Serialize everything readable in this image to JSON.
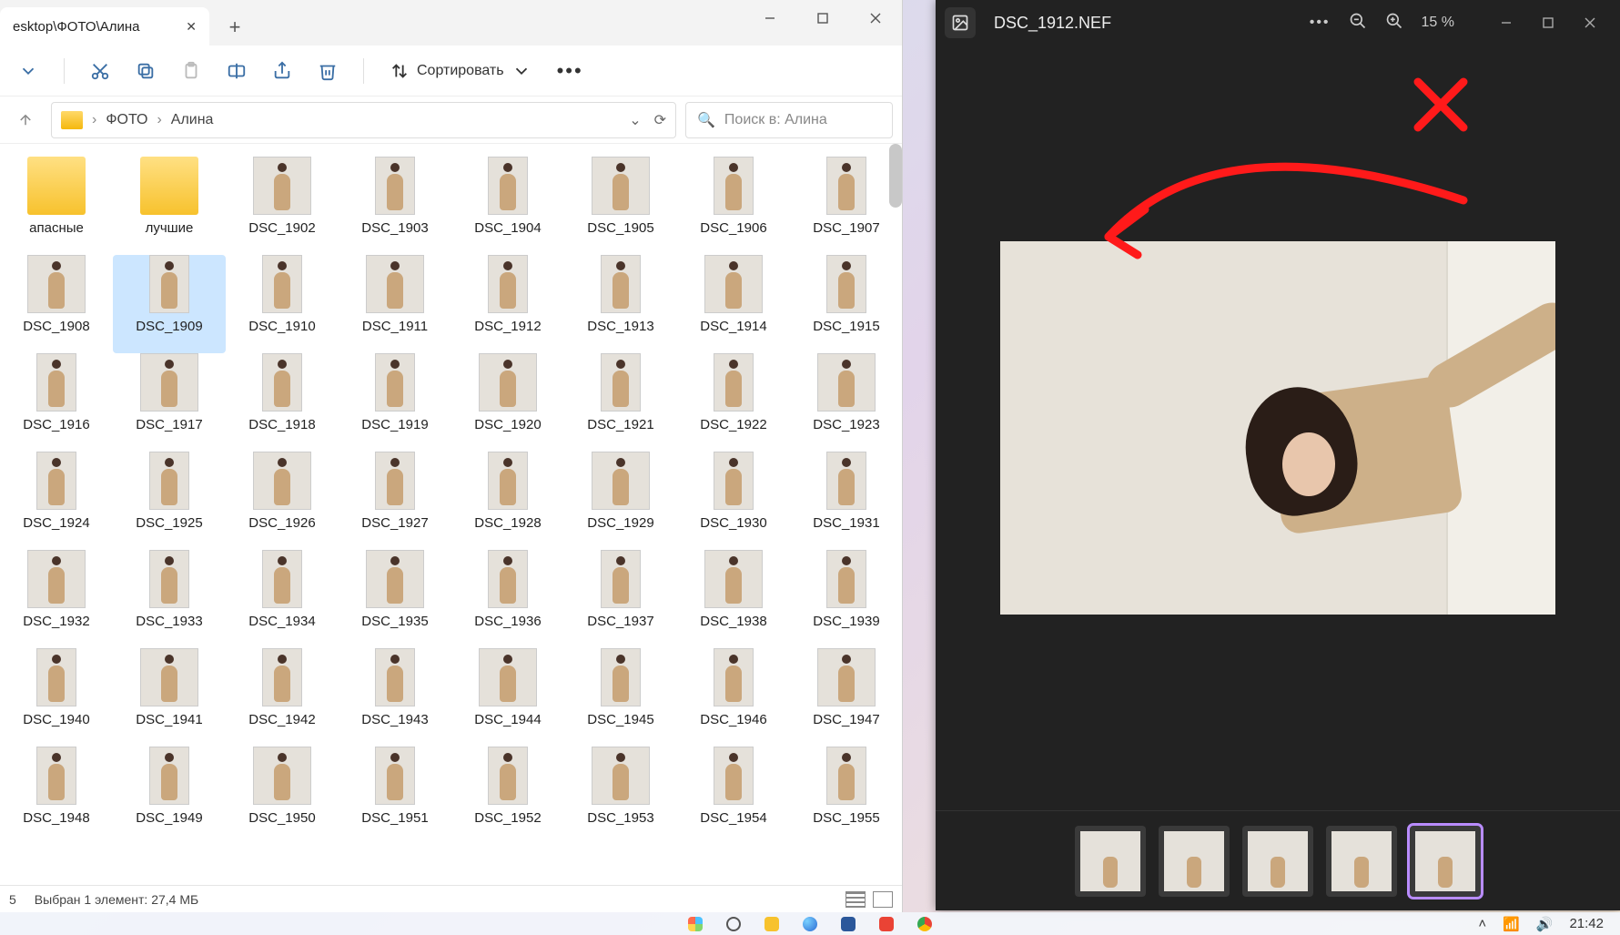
{
  "explorer": {
    "tab_title": "esktop\\ФОТО\\Алина",
    "new_button": "+",
    "sort_label": "Сортировать",
    "breadcrumb": {
      "root": "ФОТО",
      "current": "Алина"
    },
    "search_placeholder": "Поиск в: Алина",
    "folders": [
      "апасные",
      "лучшие"
    ],
    "files": [
      "DSC_1902",
      "DSC_1903",
      "DSC_1904",
      "DSC_1905",
      "DSC_1906",
      "DSC_1907",
      "DSC_1908",
      "DSC_1909",
      "DSC_1910",
      "DSC_1911",
      "DSC_1912",
      "DSC_1913",
      "DSC_1914",
      "DSC_1915",
      "DSC_1916",
      "DSC_1917",
      "DSC_1918",
      "DSC_1919",
      "DSC_1920",
      "DSC_1921",
      "DSC_1922",
      "DSC_1923",
      "DSC_1924",
      "DSC_1925",
      "DSC_1926",
      "DSC_1927",
      "DSC_1928",
      "DSC_1929",
      "DSC_1930",
      "DSC_1931",
      "DSC_1932",
      "DSC_1933",
      "DSC_1934",
      "DSC_1935",
      "DSC_1936",
      "DSC_1937",
      "DSC_1938",
      "DSC_1939",
      "DSC_1940",
      "DSC_1941",
      "DSC_1942",
      "DSC_1943",
      "DSC_1944",
      "DSC_1945",
      "DSC_1946",
      "DSC_1947",
      "DSC_1948",
      "DSC_1949",
      "DSC_1950",
      "DSC_1951",
      "DSC_1952",
      "DSC_1953",
      "DSC_1954",
      "DSC_1955"
    ],
    "selected_file": "DSC_1909",
    "status_count": "5",
    "status_selection": "Выбран 1 элемент: 27,4 МБ"
  },
  "photos": {
    "filename": "DSC_1912.NEF",
    "zoom": "15 %",
    "filmstrip_count": 5,
    "filmstrip_current_index": 4
  },
  "taskbar": {
    "clock": "21:42"
  }
}
